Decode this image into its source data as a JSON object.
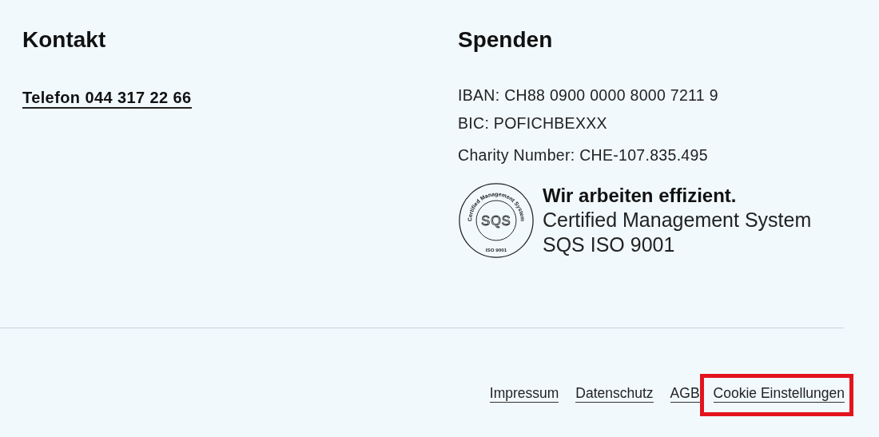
{
  "contact": {
    "heading": "Kontakt",
    "phone_link": "Telefon 044 317 22 66"
  },
  "donations": {
    "heading": "Spenden",
    "lines": [
      "IBAN: CH88 0900 0000 8000 7211 9",
      "BIC: POFICHBEXXX"
    ],
    "charity": "Charity Number: CHE-107.835.495",
    "seal": {
      "arc_text": "Certified Management System",
      "center_text": "SQS",
      "bottom_text": "ISO 9001"
    },
    "certificate": {
      "title": "Wir arbeiten effizient.",
      "lines": [
        "Certified Management System",
        "SQS ISO 9001"
      ]
    }
  },
  "footer_links": [
    {
      "label": "Impressum",
      "highlighted": false
    },
    {
      "label": "Datenschutz",
      "highlighted": false
    },
    {
      "label": "AGB",
      "highlighted": false
    },
    {
      "label": "Cookie Einstellungen",
      "highlighted": true
    }
  ]
}
